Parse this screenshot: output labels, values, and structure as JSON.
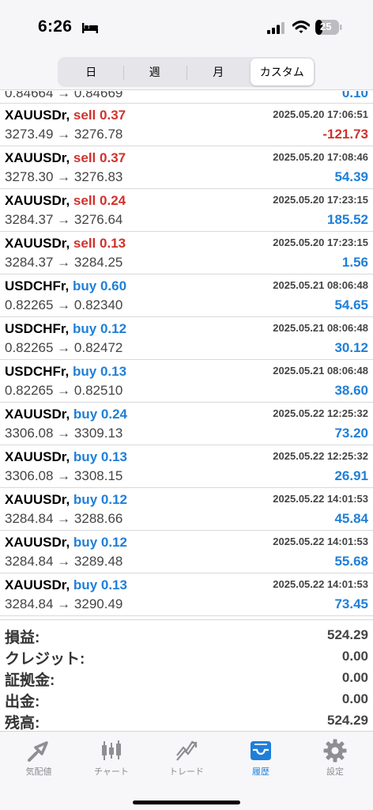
{
  "status_bar": {
    "time": "6:26",
    "battery": "25"
  },
  "segments": [
    {
      "label": "日",
      "active": false
    },
    {
      "label": "週",
      "active": false
    },
    {
      "label": "月",
      "active": false
    },
    {
      "label": "カスタム",
      "active": true
    }
  ],
  "partial_row": {
    "prices": "0.84664 → 0.84669",
    "profit": "0.10"
  },
  "trades": [
    {
      "symbol": "XAUUSDr,",
      "side": "sell",
      "lots": "0.37",
      "time": "2025.05.20 17:06:51",
      "open": "3273.49",
      "close": "3276.78",
      "profit": "-121.73"
    },
    {
      "symbol": "XAUUSDr,",
      "side": "sell",
      "lots": "0.37",
      "time": "2025.05.20 17:08:46",
      "open": "3278.30",
      "close": "3276.83",
      "profit": "54.39"
    },
    {
      "symbol": "XAUUSDr,",
      "side": "sell",
      "lots": "0.24",
      "time": "2025.05.20 17:23:15",
      "open": "3284.37",
      "close": "3276.64",
      "profit": "185.52"
    },
    {
      "symbol": "XAUUSDr,",
      "side": "sell",
      "lots": "0.13",
      "time": "2025.05.20 17:23:15",
      "open": "3284.37",
      "close": "3284.25",
      "profit": "1.56"
    },
    {
      "symbol": "USDCHFr,",
      "side": "buy",
      "lots": "0.60",
      "time": "2025.05.21 08:06:48",
      "open": "0.82265",
      "close": "0.82340",
      "profit": "54.65"
    },
    {
      "symbol": "USDCHFr,",
      "side": "buy",
      "lots": "0.12",
      "time": "2025.05.21 08:06:48",
      "open": "0.82265",
      "close": "0.82472",
      "profit": "30.12"
    },
    {
      "symbol": "USDCHFr,",
      "side": "buy",
      "lots": "0.13",
      "time": "2025.05.21 08:06:48",
      "open": "0.82265",
      "close": "0.82510",
      "profit": "38.60"
    },
    {
      "symbol": "XAUUSDr,",
      "side": "buy",
      "lots": "0.24",
      "time": "2025.05.22 12:25:32",
      "open": "3306.08",
      "close": "3309.13",
      "profit": "73.20"
    },
    {
      "symbol": "XAUUSDr,",
      "side": "buy",
      "lots": "0.13",
      "time": "2025.05.22 12:25:32",
      "open": "3306.08",
      "close": "3308.15",
      "profit": "26.91"
    },
    {
      "symbol": "XAUUSDr,",
      "side": "buy",
      "lots": "0.12",
      "time": "2025.05.22 14:01:53",
      "open": "3284.84",
      "close": "3288.66",
      "profit": "45.84"
    },
    {
      "symbol": "XAUUSDr,",
      "side": "buy",
      "lots": "0.12",
      "time": "2025.05.22 14:01:53",
      "open": "3284.84",
      "close": "3289.48",
      "profit": "55.68"
    },
    {
      "symbol": "XAUUSDr,",
      "side": "buy",
      "lots": "0.13",
      "time": "2025.05.22 14:01:53",
      "open": "3284.84",
      "close": "3290.49",
      "profit": "73.45"
    }
  ],
  "summary": [
    {
      "label": "損益:",
      "value": "524.29"
    },
    {
      "label": "クレジット:",
      "value": "0.00"
    },
    {
      "label": "証拠金:",
      "value": "0.00"
    },
    {
      "label": "出金:",
      "value": "0.00"
    },
    {
      "label": "残高:",
      "value": "524.29"
    }
  ],
  "tabs": [
    {
      "label": "気配値",
      "icon": "quotes-icon",
      "active": false
    },
    {
      "label": "チャート",
      "icon": "chart-icon",
      "active": false
    },
    {
      "label": "トレード",
      "icon": "trade-icon",
      "active": false
    },
    {
      "label": "履歴",
      "icon": "history-icon",
      "active": true
    },
    {
      "label": "設定",
      "icon": "gear-icon",
      "active": false
    }
  ],
  "colors": {
    "sell": "#d2322d",
    "buy": "#1f7fd8",
    "active_tab": "#1f7fd8",
    "inactive_tab": "#8e8e93"
  }
}
